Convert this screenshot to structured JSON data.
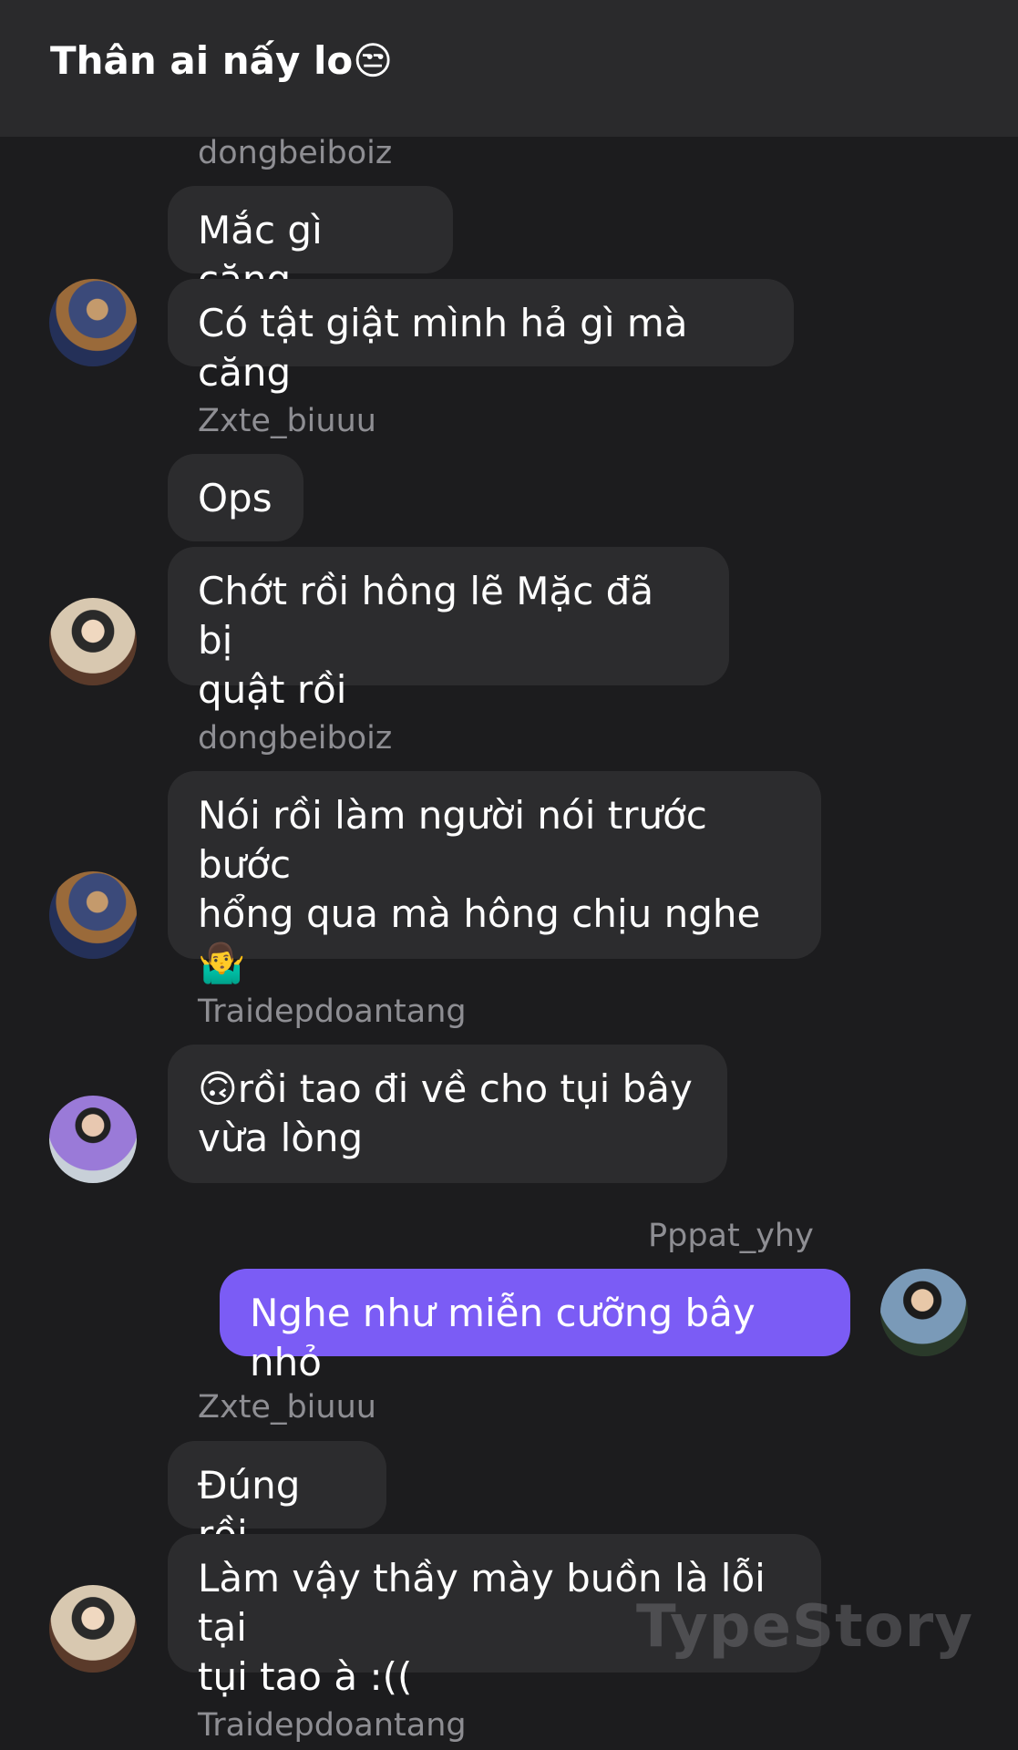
{
  "header": {
    "title": "Thân ai nấy lo😒"
  },
  "messages": [
    {
      "user": "dongbeiboiz",
      "texts": [
        "Mắc gì căng",
        "Có tật giật mình hả gì mà căng"
      ]
    },
    {
      "user": "Zxte_biuuu",
      "texts": [
        "Ops",
        "Chớt rồi hông lẽ Mặc đã bị\nquật rồi"
      ]
    },
    {
      "user": "dongbeiboiz",
      "texts": [
        "Nói rồi làm người nói trước bước\nhổng qua mà hông chịu nghe\n🤷‍♂️"
      ]
    },
    {
      "user": "Traidepdoantang",
      "texts": [
        "🙃rồi tao đi về cho tụi bây\nvừa lòng"
      ]
    },
    {
      "user": "Pppat_yhy",
      "texts": [
        "Nghe như miễn cưỡng bây nhỏ"
      ]
    },
    {
      "user": "Zxte_biuuu",
      "texts": [
        "Đúng rồi",
        "Làm vậy thầy mày buồn là lỗi tại\ntụi tao à :(("
      ]
    },
    {
      "user": "Traidepdoantang",
      "texts": []
    }
  ],
  "watermark": "TypeStory",
  "colors": {
    "background": "#1c1c1e",
    "header": "#2a2a2c",
    "bubble_other": "#2c2c2e",
    "bubble_mine": "#7b5cf5",
    "username": "#8e8e93"
  }
}
